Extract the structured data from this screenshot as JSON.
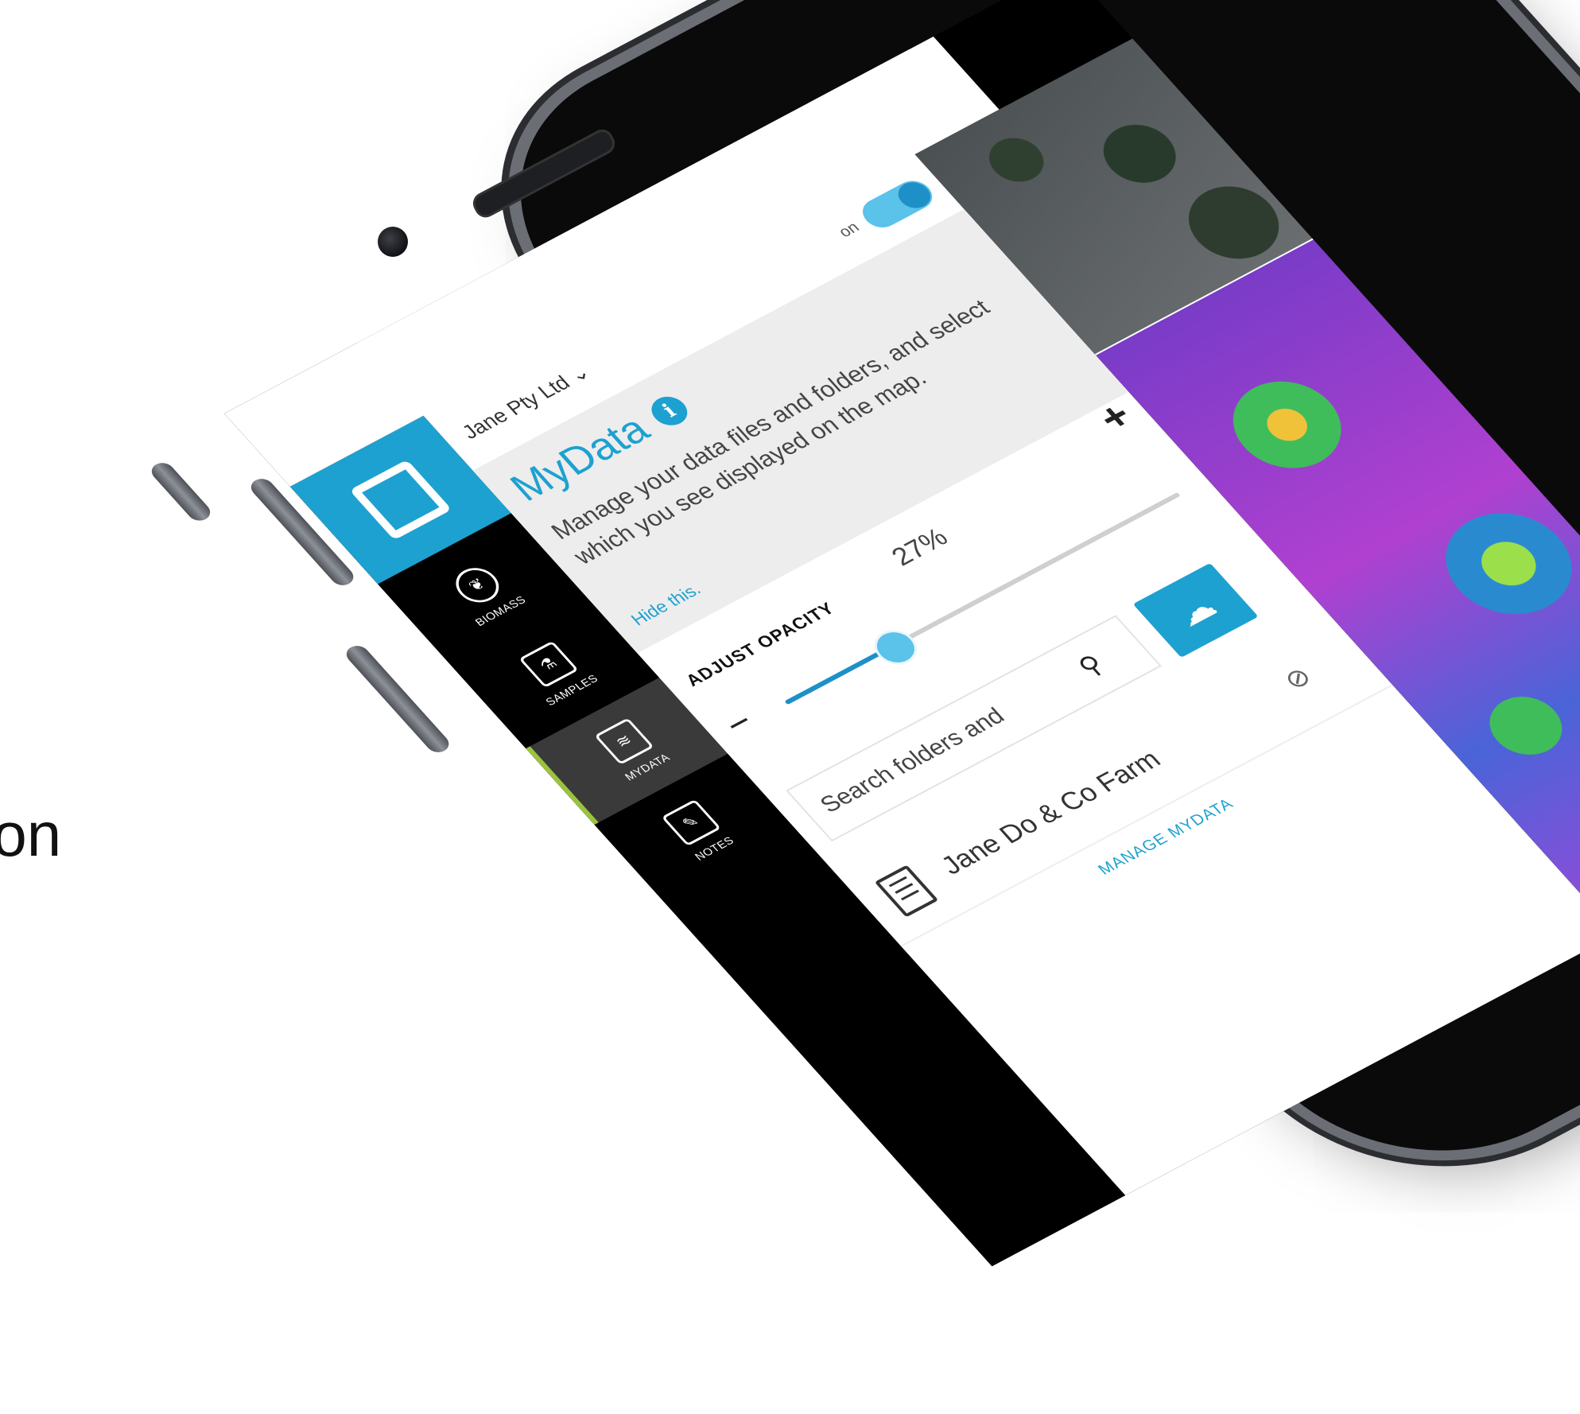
{
  "slide": {
    "partial_text": "ation"
  },
  "app": {
    "company": "Jane Pty Ltd",
    "company_chevron_icon": "chevron-down-icon",
    "toggle_label": "on",
    "toggle_state": true,
    "colors": {
      "accent": "#1da1d0",
      "active_rail": "#9ac43c",
      "slider": "#5bc2ea"
    }
  },
  "rail": {
    "items": [
      {
        "label": "BIOMASS",
        "icon": "leaf-icon"
      },
      {
        "label": "SAMPLES",
        "icon": "test-tube-icon"
      },
      {
        "label": "MYDATA",
        "icon": "stack-icon",
        "active": true
      },
      {
        "label": "NOTES",
        "icon": "pencil-note-icon"
      }
    ]
  },
  "mydata": {
    "title": "MyData",
    "description": "Manage your data files and folders, and select which you see displayed on the map.",
    "hide_link": "Hide this."
  },
  "opacity": {
    "label": "ADJUST OPACITY",
    "value_text": "27%",
    "value": 0.27,
    "minus": "−",
    "plus": "+"
  },
  "search": {
    "value": "Search folders and"
  },
  "list": {
    "items": [
      {
        "name": "Jane Do & Co Farm",
        "icon": "document-icon"
      }
    ],
    "manage_link": "MANAGE MYDATA"
  }
}
